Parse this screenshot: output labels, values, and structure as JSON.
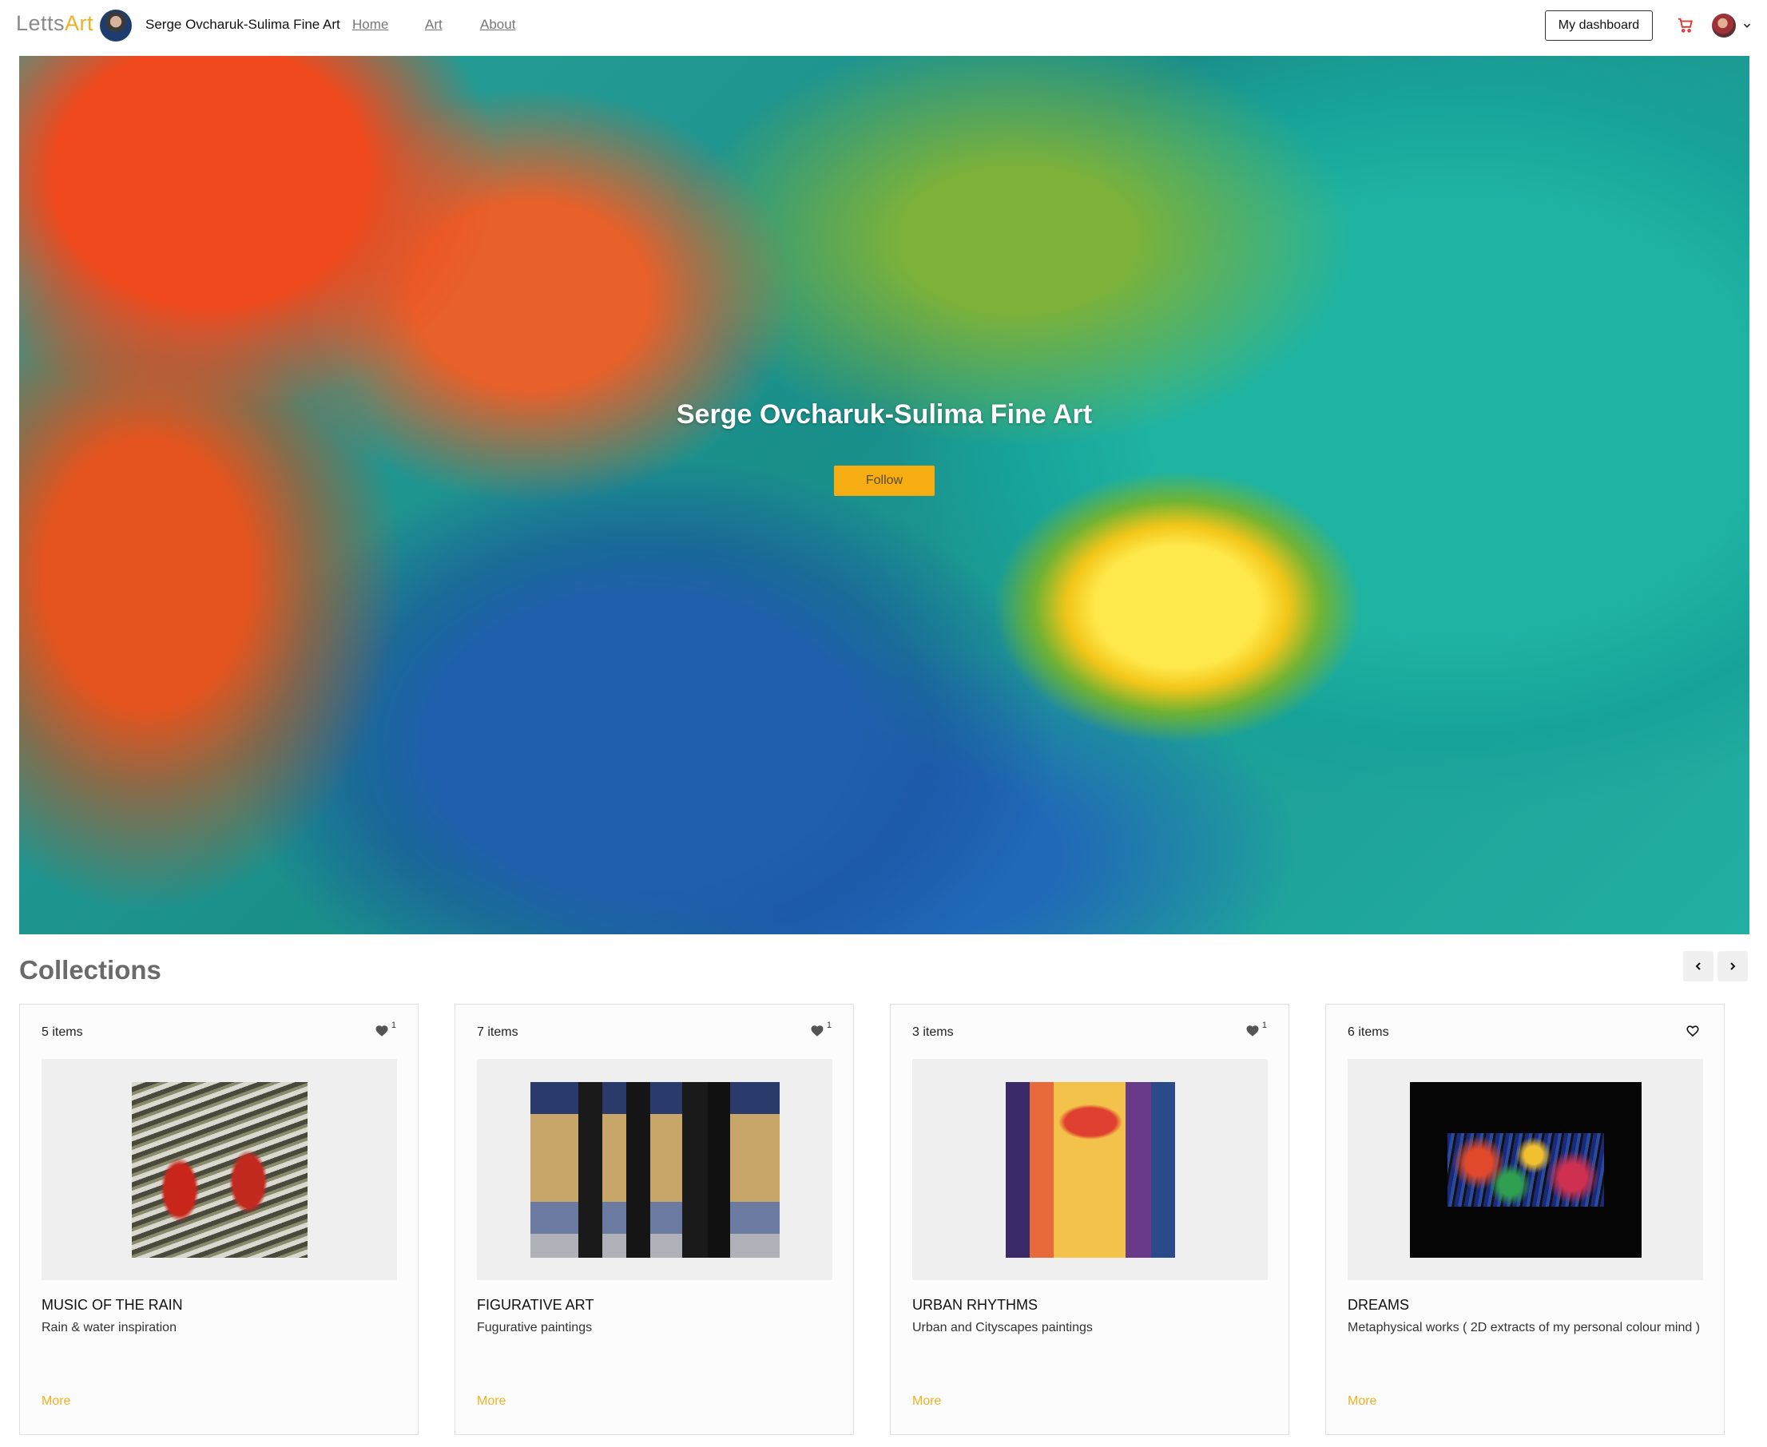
{
  "nav": {
    "logo_part1": "Letts",
    "logo_part2": "Art",
    "artist_name": "Serge Ovcharuk-Sulima Fine Art",
    "links": [
      "Home",
      "Art",
      "About"
    ],
    "dashboard_label": "My dashboard",
    "icons": [
      "shopping-cart-icon",
      "user-avatar",
      "chevron-down-icon"
    ]
  },
  "hero": {
    "title": "Serge Ovcharuk-Sulima Fine Art",
    "follow_label": "Follow"
  },
  "collections": {
    "heading": "Collections",
    "items": [
      {
        "count": "5 items",
        "likes": "1",
        "title": "MUSIC OF THE RAIN",
        "desc": "Rain & water inspiration",
        "more": "More"
      },
      {
        "count": "7 items",
        "likes": "1",
        "title": "FIGURATIVE ART",
        "desc": "Fugurative paintings",
        "more": "More"
      },
      {
        "count": "3 items",
        "likes": "1",
        "title": "URBAN RHYTHMS",
        "desc": "Urban and Cityscapes paintings",
        "more": "More"
      },
      {
        "count": "6 items",
        "likes": "",
        "title": "DREAMS",
        "desc": "Metaphysical works ( 2D extracts of my personal colour mind )",
        "more": "More"
      }
    ]
  },
  "colors": {
    "accent": "#f0b020",
    "follow_button": "#f5ad11",
    "cart_icon": "#e0302a"
  }
}
